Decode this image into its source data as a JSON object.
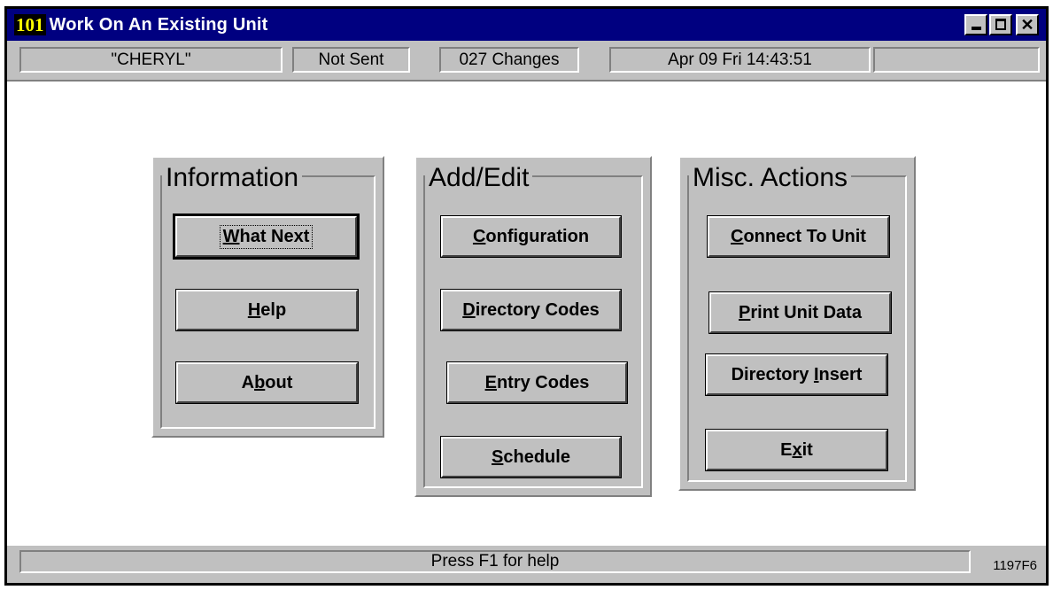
{
  "window": {
    "title": "Work On An Existing Unit",
    "icon_label": "101"
  },
  "status_top": {
    "unit_name": "\"CHERYL\"",
    "send_status": "Not Sent",
    "changes": "027 Changes",
    "datetime": "Apr 09  Fri  14:43:51",
    "extra": ""
  },
  "groups": {
    "information": {
      "title": "Information",
      "buttons": {
        "what_next": {
          "pre": "",
          "key": "W",
          "post": "hat Next"
        },
        "help": {
          "pre": "",
          "key": "H",
          "post": "elp"
        },
        "about": {
          "pre": "A",
          "key": "b",
          "post": "out"
        }
      }
    },
    "add_edit": {
      "title": "Add/Edit",
      "buttons": {
        "configuration": {
          "pre": "",
          "key": "C",
          "post": "onfiguration"
        },
        "directory_codes": {
          "pre": "",
          "key": "D",
          "post": "irectory Codes"
        },
        "entry_codes": {
          "pre": "",
          "key": "E",
          "post": "ntry Codes"
        },
        "schedule": {
          "pre": "",
          "key": "S",
          "post": "chedule"
        }
      }
    },
    "misc": {
      "title": "Misc. Actions",
      "buttons": {
        "connect": {
          "pre": "",
          "key": "C",
          "post": "onnect To Unit"
        },
        "print": {
          "pre": "",
          "key": "P",
          "post": "rint Unit Data"
        },
        "directory_insert": {
          "pre": "Directory ",
          "key": "I",
          "post": "nsert"
        },
        "exit": {
          "pre": "E",
          "key": "x",
          "post": "it"
        }
      }
    }
  },
  "status_bottom": {
    "help_text": "Press F1 for help",
    "figure_id": "1197F6"
  },
  "colors": {
    "titlebar": "#000080",
    "face": "#c0c0c0",
    "icon_text": "#ffff00"
  }
}
